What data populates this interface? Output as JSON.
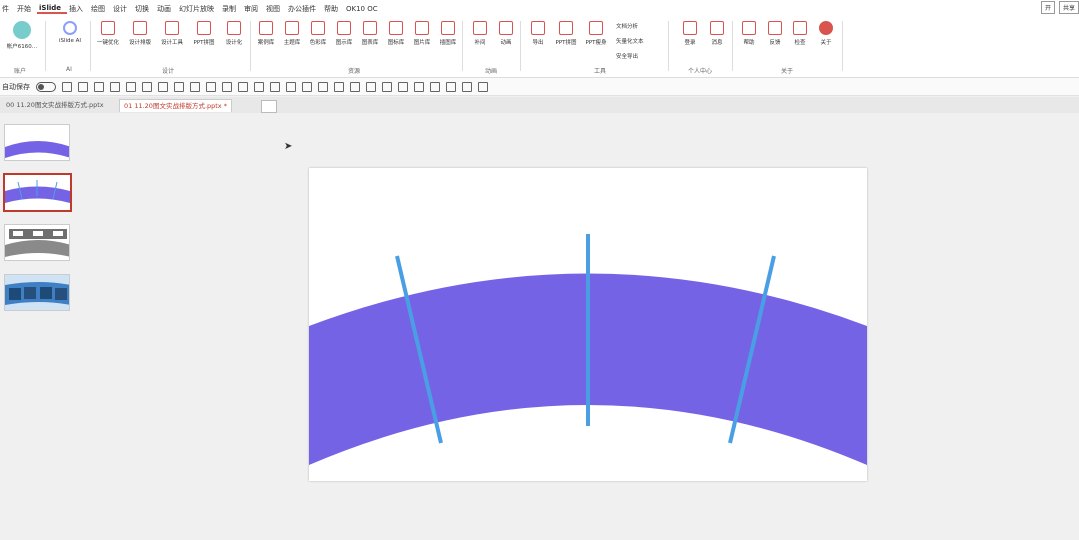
{
  "menu": {
    "items": [
      "件",
      "开始",
      "iSlide",
      "插入",
      "绘图",
      "设计",
      "切换",
      "动画",
      "幻灯片放映",
      "录制",
      "审阅",
      "视图",
      "办公插件",
      "帮助",
      "OK10 OC"
    ],
    "active": "iSlide",
    "right_buttons": [
      "开",
      "共享"
    ]
  },
  "ribbon": {
    "account_label": "帐户6160…",
    "ai_label": "iSlide AI",
    "buttons": [
      "一键优化",
      "设计排版",
      "设计工具",
      "PPT拼图",
      "设计化",
      "案例库",
      "主题库",
      "色彩库",
      "图示库",
      "图表库",
      "图标库",
      "图片库",
      "插图库",
      "补间",
      "动画",
      "导出",
      "PPT拼图",
      "PPT瘦身",
      "登录",
      "消息",
      "帮助",
      "反馈",
      "检查",
      "关于"
    ],
    "small_items": [
      "文档分析",
      "矢量化文本",
      "安全导出"
    ],
    "groups": [
      "账户",
      "AI",
      "设计",
      "资源",
      "动画",
      "工具",
      "个人中心",
      "关于"
    ]
  },
  "qat": {
    "toggle_label": "自动保存"
  },
  "tabs": [
    {
      "label": "00 11.20图文实战排版方式.pptx",
      "active": false
    },
    {
      "label": "01 11.20图文实战排版方式.pptx *",
      "active": true
    }
  ],
  "slide": {
    "arc_color": "#7563e6",
    "line_color": "#4a9fe4"
  },
  "thumbnails": [
    {
      "selected": false
    },
    {
      "selected": true
    },
    {
      "selected": false
    },
    {
      "selected": false
    }
  ]
}
